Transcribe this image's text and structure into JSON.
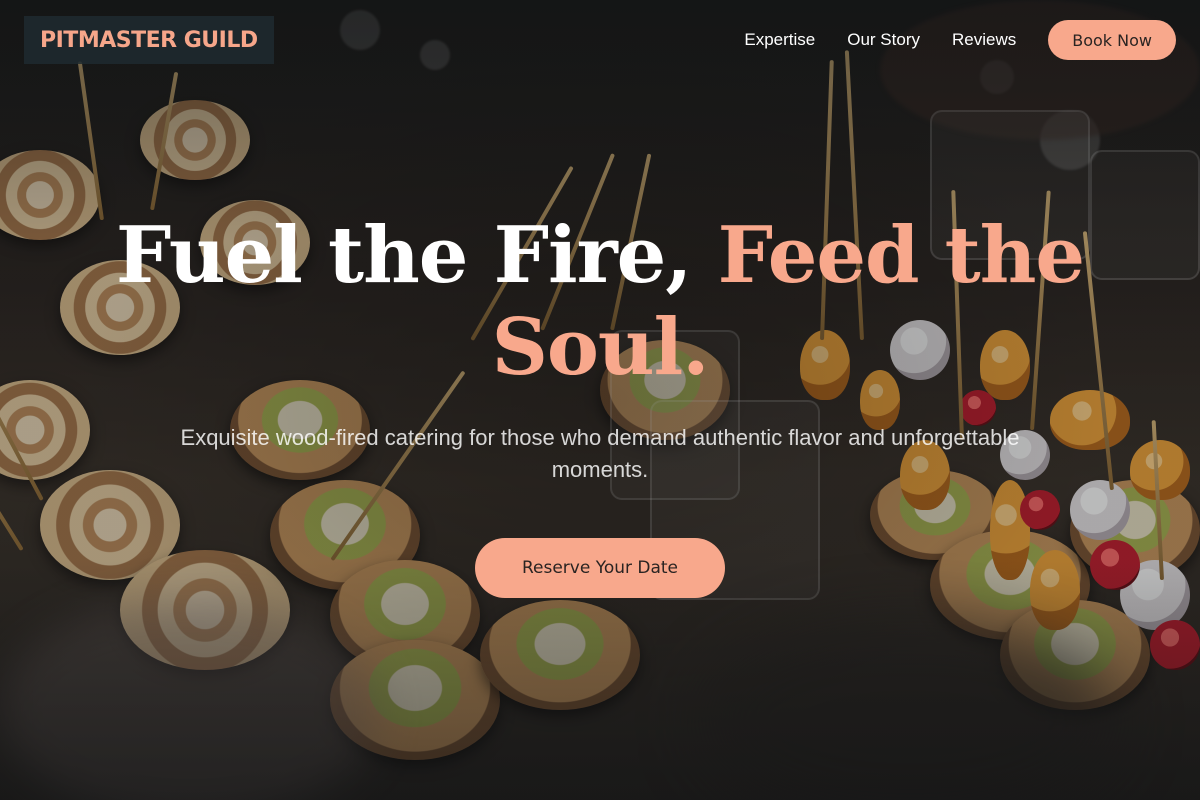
{
  "header": {
    "logo": "PITMASTER GUILD",
    "nav": [
      {
        "label": "Expertise"
      },
      {
        "label": "Our Story"
      },
      {
        "label": "Reviews"
      }
    ],
    "cta_label": "Book Now"
  },
  "hero": {
    "headline_part1": "Fuel the Fire,",
    "headline_part2": "Feed the Soul.",
    "subtitle": "Exquisite wood-fired catering for those who demand authentic flavor and unforgettable moments.",
    "cta_label": "Reserve Your Date"
  },
  "colors": {
    "accent": "#f8a88c",
    "logo_bg": "#1e2a30",
    "text": "#ffffff"
  }
}
